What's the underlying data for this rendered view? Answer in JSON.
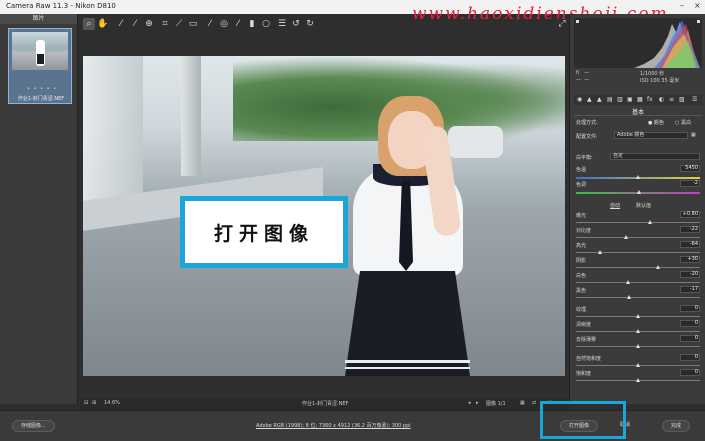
{
  "titlebar": {
    "title": "Camera Raw 11.3  -  Nikon D810",
    "watermark": "www.haoxidienshoji.com"
  },
  "filmstrip": {
    "header": "图片",
    "stars": "• • • • •",
    "filename": "作业1-封门青涩.NEF"
  },
  "toolbar": {
    "tools": [
      "zoom-icon",
      "hand-icon",
      "white-balance-icon",
      "color-sampler-icon",
      "target-adjust-icon",
      "crop-icon",
      "straighten-icon",
      "transform-icon",
      "spot-removal-icon",
      "red-eye-icon",
      "adjustment-brush-icon",
      "graduated-filter-icon",
      "radial-filter-icon",
      "preferences-icon",
      "rotate-left-icon",
      "rotate-right-icon"
    ]
  },
  "callout": {
    "text": "打开图像"
  },
  "panel": {
    "cam_left": [
      "f/",
      "ISO"
    ],
    "cam_right": [
      "1/1000 秒",
      "ISO 100  35 毫米"
    ],
    "cam_ticks": [
      "f/",
      "—",
      "—",
      "—"
    ],
    "section": "基本",
    "process_label": "处理方式:",
    "process_color": "颜色",
    "process_bw": "黑白",
    "profile_label": "配置文件:",
    "profile_value": "Adobe 颜色",
    "wb_label": "白平衡:",
    "wb_value": "自定",
    "auto": "自动",
    "default": "默认值",
    "temp": {
      "label": "色温",
      "value": "5450"
    },
    "tint": {
      "label": "色调",
      "value": "-2"
    },
    "exposure": {
      "label": "曝光",
      "value": "+0.80"
    },
    "contrast": {
      "label": "对比度",
      "value": "-22"
    },
    "highlights": {
      "label": "高光",
      "value": "-64"
    },
    "shadows": {
      "label": "阴影",
      "value": "+30"
    },
    "whites": {
      "label": "白色",
      "value": "-20"
    },
    "blacks": {
      "label": "黑色",
      "value": "-17"
    },
    "texture": {
      "label": "纹理",
      "value": "0"
    },
    "clarity": {
      "label": "清晰度",
      "value": "0"
    },
    "dehaze": {
      "label": "去除薄雾",
      "value": "0"
    },
    "vibrance": {
      "label": "自然饱和度",
      "value": "0"
    },
    "saturation": {
      "label": "饱和度",
      "value": "0"
    }
  },
  "statusbar": {
    "zoom": "14.6%",
    "filename": "作业1-封门青涩.NEF",
    "image_count": "图像 1/1"
  },
  "bottombar": {
    "save_label": "存储图像...",
    "info_link": "Adobe RGB (1998); 8 位; 7360 x 4912 (36.2 百万像素); 300 ppi",
    "open_label": "打开图像",
    "cancel_label": "取消",
    "done_label": "完成"
  },
  "colors": {
    "accent_highlight": "#1aa6da",
    "watermark": "#e8203c"
  }
}
